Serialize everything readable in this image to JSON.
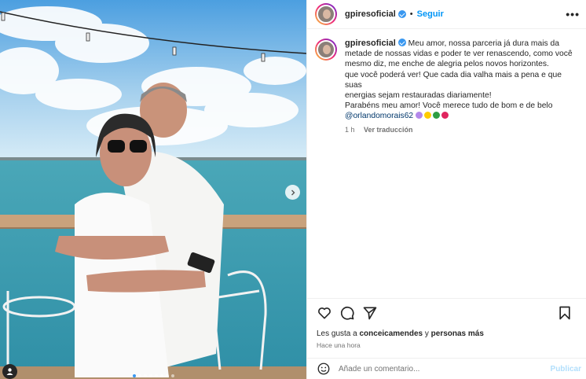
{
  "post": {
    "username": "gpiresoficial",
    "follow_label": "Seguir",
    "dot": "•",
    "more_label": "•••",
    "caption_lines": [
      "Meu amor, nossa parceria já dura mais da",
      "metade de nossas vidas e poder te ver renascendo, como você",
      "mesmo diz, me enche de alegria pelos novos horizontes.",
      "que você poderá ver! Que cada dia valha mais a pena e que suas",
      "energias sejam restauradas diariamente!",
      "Parabéns meu amor! Você merece tudo de bom e de belo"
    ],
    "mention": "@orlandomorais62",
    "emojis": [
      "flower-emoji",
      "sun-emoji",
      "clover-emoji",
      "heart-emoji"
    ],
    "emoji_colors": [
      "#b388eb",
      "#ffcc00",
      "#2e9e44",
      "#e0245e"
    ],
    "time_short": "1 h",
    "translate_label": "Ver traducción",
    "likes_prefix": "Les gusta a ",
    "likes_user": "conceicamendes",
    "likes_middle": " y ",
    "likes_others": "personas más",
    "time_ago": "Hace una hora",
    "comment_placeholder": "Añade un comentario...",
    "publish_label": "Publicar"
  },
  "carousel": {
    "count": 8,
    "active_index": 0
  },
  "colors": {
    "accent": "#0095f6",
    "verified": "#3897f0",
    "like_heart": "#262626"
  }
}
